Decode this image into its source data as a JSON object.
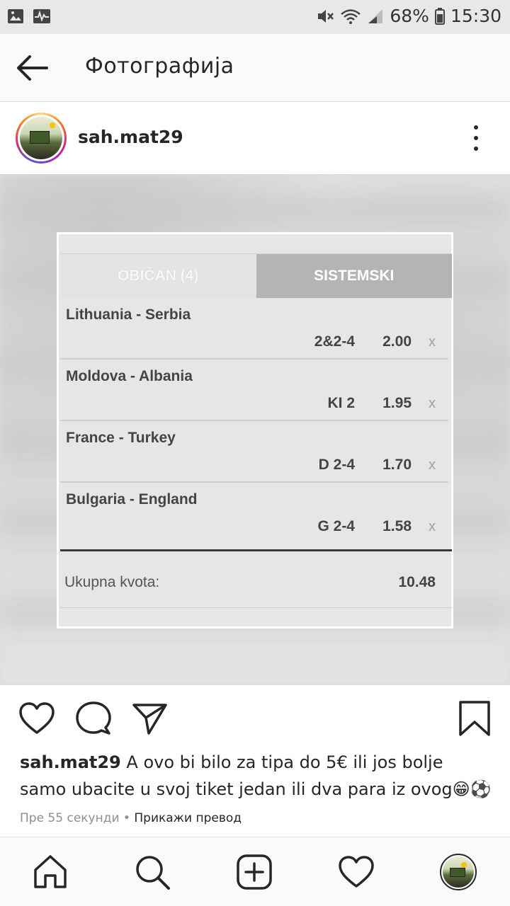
{
  "status_bar": {
    "battery": "68%",
    "time": "15:30",
    "icons": [
      "image-icon",
      "activity-icon",
      "mute-icon",
      "wifi-icon",
      "signal-icon",
      "battery-icon"
    ]
  },
  "header": {
    "title": "Фотографија",
    "back_icon": "arrow-left-icon"
  },
  "post": {
    "username": "sah.mat29",
    "more_icon": "more-vertical-icon"
  },
  "ticket": {
    "tabs": [
      {
        "label": "OBIČAN (4)",
        "active": true
      },
      {
        "label": "SISTEMSKI",
        "active": false
      }
    ],
    "matches": [
      {
        "name": "Lithuania - Serbia",
        "pick": "2&2-4",
        "odd": "2.00",
        "remove": "x"
      },
      {
        "name": "Moldova - Albania",
        "pick": "KI 2",
        "odd": "1.95",
        "remove": "x"
      },
      {
        "name": "France - Turkey",
        "pick": "D 2-4",
        "odd": "1.70",
        "remove": "x"
      },
      {
        "name": "Bulgaria - England",
        "pick": "G 2-4",
        "odd": "1.58",
        "remove": "x"
      }
    ],
    "total_label": "Ukupna kvota:",
    "total_value": "10.48"
  },
  "actions": {
    "icons": [
      "heart-icon",
      "comment-icon",
      "share-icon",
      "bookmark-icon"
    ]
  },
  "caption": {
    "username": "sah.mat29",
    "text": " A ovo bi bilo za tipa do 5€ ili jos bolje samo ubacite u svoj tiket jedan ili dva para iz ovog😁⚽"
  },
  "meta": {
    "time_ago": "Пре 55 секунди",
    "separator": " • ",
    "translate": "Прикажи превод"
  },
  "bottom_nav": {
    "icons": [
      "home-icon",
      "search-icon",
      "new-post-icon",
      "activity-heart-icon",
      "profile-avatar"
    ]
  },
  "colors": {
    "tab_inactive": "#b4b4b4",
    "text_primary": "#262626",
    "text_secondary": "#8e8e8e"
  }
}
